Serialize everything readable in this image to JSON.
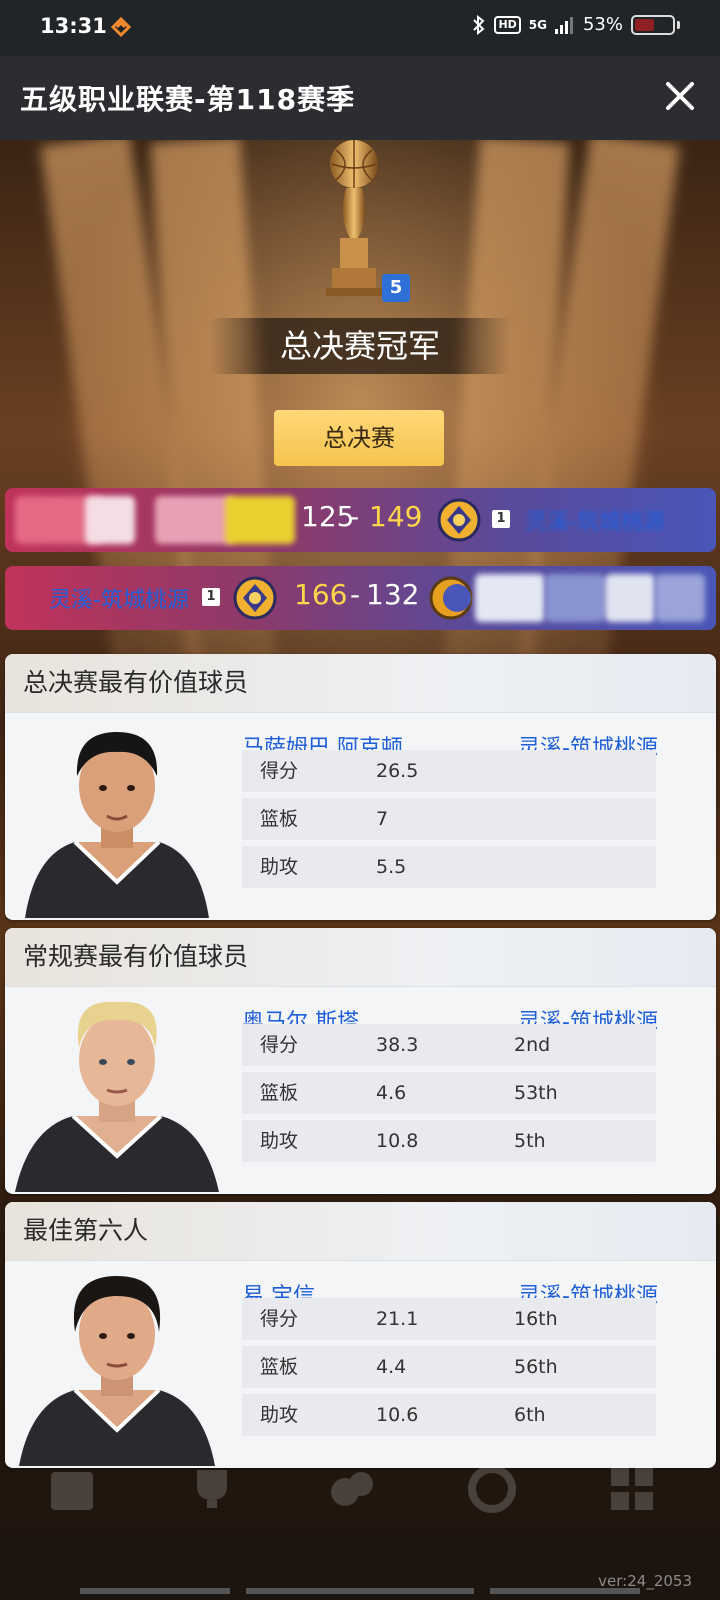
{
  "status_bar": {
    "time": "13:31",
    "network": "5G",
    "hd": "HD",
    "battery": "53%",
    "battery_level": 0.53
  },
  "header": {
    "title": "五级职业联赛-第118赛季",
    "close_icon": "close-icon"
  },
  "trophy": {
    "badge": "5",
    "champion_label": "总决赛冠军"
  },
  "finals_button": "总决赛",
  "games": [
    {
      "left_score": "125",
      "separator": "-",
      "right_score": "149",
      "right_seed": "1",
      "right_team": "灵溪-筑城桃源"
    },
    {
      "left_team": "灵溪-筑城桃源",
      "left_seed": "1",
      "left_score": "166",
      "separator": "-",
      "right_score": "132"
    }
  ],
  "awards": [
    {
      "title": "总决赛最有价值球员",
      "player": "马萨姆巴 阿克顿",
      "team": "灵溪-筑城桃源",
      "stats": [
        {
          "label": "得分",
          "value": "26.5",
          "rank": ""
        },
        {
          "label": "篮板",
          "value": "7",
          "rank": ""
        },
        {
          "label": "助攻",
          "value": "5.5",
          "rank": ""
        }
      ]
    },
    {
      "title": "常规赛最有价值球员",
      "player": "奥马尔 斯塔",
      "team": "灵溪-筑城桃源",
      "stats": [
        {
          "label": "得分",
          "value": "38.3",
          "rank": "2nd"
        },
        {
          "label": "篮板",
          "value": "4.6",
          "rank": "53th"
        },
        {
          "label": "助攻",
          "value": "10.8",
          "rank": "5th"
        }
      ]
    },
    {
      "title": "最佳第六人",
      "player": "易 宝信",
      "team": "灵溪-筑城桃源",
      "stats": [
        {
          "label": "得分",
          "value": "21.1",
          "rank": "16th"
        },
        {
          "label": "篮板",
          "value": "4.4",
          "rank": "56th"
        },
        {
          "label": "助攻",
          "value": "10.6",
          "rank": "6th"
        }
      ]
    }
  ],
  "version": "ver:24_2053",
  "colors": {
    "accent_blue": "#1e5fd8",
    "gold": "#ffd54a",
    "button_gold": "#f6c44e"
  }
}
